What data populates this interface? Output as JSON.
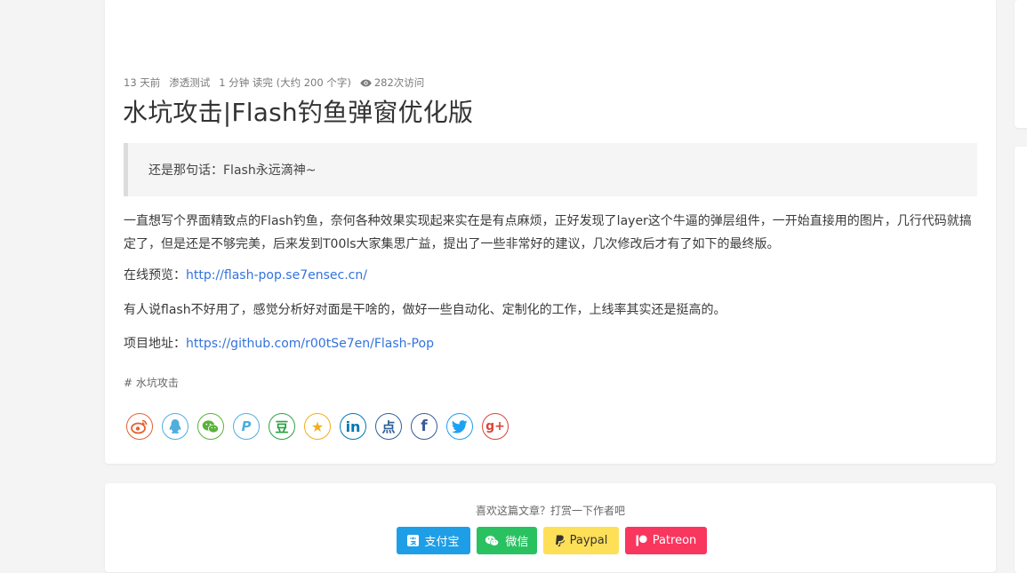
{
  "article": {
    "meta": {
      "date": "13 天前",
      "category": "渗透测试",
      "read_time": "1 分钟 读完 (大约 200 个字)",
      "views": "282次访问"
    },
    "title": "水坑攻击|Flash钓鱼弹窗优化版",
    "quote": "还是那句话：Flash永远滴神~",
    "paragraphs": {
      "p1": "一直想写个界面精致点的Flash钓鱼，奈何各种效果实现起来实在是有点麻烦，正好发现了layer这个牛逼的弹层组件，一开始直接用的图片，几行代码就搞定了，但是还是不够完美，后来发到T00ls大家集思广益，提出了一些非常好的建议，几次修改后才有了如下的最终版。",
      "p2_label": "在线预览：",
      "p2_link": "http://flash-pop.se7ensec.cn/",
      "p3": "有人说flash不好用了，感觉分析好对面是干啥的，做好一些自动化、定制化的工作，上线率其实还是挺高的。",
      "p4_label": "项目地址：",
      "p4_link": "https://github.com/r00tSe7en/Flash-Pop"
    },
    "tag": "# 水坑攻击",
    "share": [
      {
        "icon": "weibo-icon",
        "color": "#e6612e"
      },
      {
        "icon": "qq-icon",
        "color": "#4faede"
      },
      {
        "icon": "wechat-icon",
        "color": "#59b13a"
      },
      {
        "icon": "tencent-weibo-icon",
        "color": "#4faede",
        "glyph": "P"
      },
      {
        "icon": "douban-icon",
        "color": "#2ca144",
        "glyph": "豆"
      },
      {
        "icon": "qzone-icon",
        "color": "#f2ad1b",
        "glyph": "★"
      },
      {
        "icon": "linkedin-icon",
        "color": "#0077b5",
        "glyph": "in"
      },
      {
        "icon": "diandian-icon",
        "color": "#2f6196",
        "glyph": "点"
      },
      {
        "icon": "facebook-icon",
        "color": "#3b5998",
        "glyph": "f"
      },
      {
        "icon": "twitter-icon",
        "color": "#1da1f2"
      },
      {
        "icon": "google-plus-icon",
        "color": "#db4437",
        "glyph": "g+"
      }
    ]
  },
  "reward": {
    "text": "喜欢这篇文章？打赏一下作者吧",
    "buttons": [
      {
        "label": "支付宝",
        "icon": "alipay-icon",
        "color": "#1e9ee6"
      },
      {
        "label": "微信",
        "icon": "wechat-pay-icon",
        "color": "#2ac161"
      },
      {
        "label": "Paypal",
        "icon": "paypal-icon",
        "color": "#fedf58",
        "text_color": "#333"
      },
      {
        "label": "Patreon",
        "icon": "patreon-icon",
        "color": "#f8365e"
      }
    ]
  }
}
